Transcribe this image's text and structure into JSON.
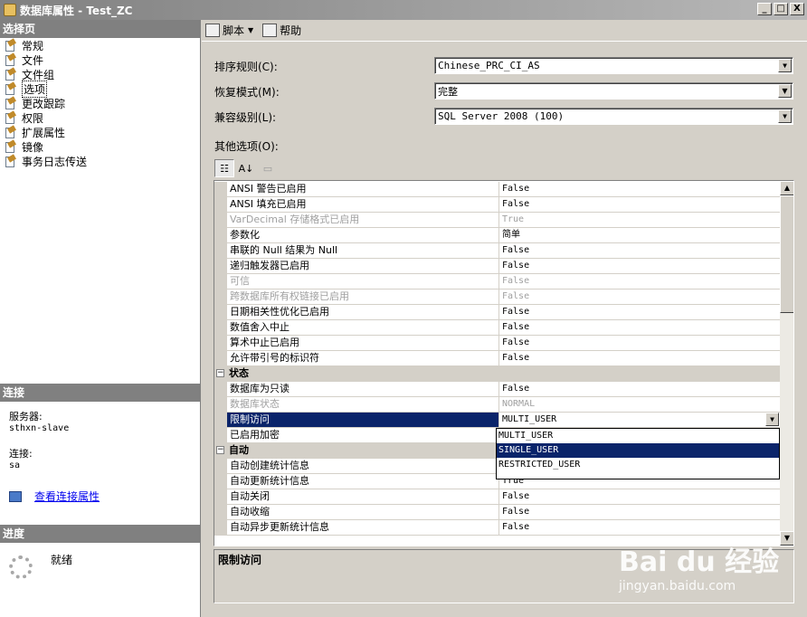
{
  "window": {
    "title": "数据库属性 - Test_ZC",
    "min": "_",
    "max": "□",
    "close": "X"
  },
  "left": {
    "select_page_header": "选择页",
    "nav_items": [
      "常规",
      "文件",
      "文件组",
      "选项",
      "更改跟踪",
      "权限",
      "扩展属性",
      "镜像",
      "事务日志传送"
    ],
    "selected": "选项",
    "connection_header": "连接",
    "server_label": "服务器:",
    "server_value": "sthxn-slave",
    "conn_label": "连接:",
    "conn_value": "sa",
    "view_conn_link": "查看连接属性",
    "progress_header": "进度",
    "progress_status": "就绪"
  },
  "toolbar": {
    "script": "脚本",
    "help": "帮助"
  },
  "form": {
    "collation_label": "排序规则(C):",
    "collation_value": "Chinese_PRC_CI_AS",
    "recovery_label": "恢复模式(M):",
    "recovery_value": "完整",
    "compat_label": "兼容级别(L):",
    "compat_value": "SQL Server 2008 (100)",
    "other_label": "其他选项(O):"
  },
  "grid": {
    "rows": [
      {
        "name": "ANSI 警告已启用",
        "value": "False"
      },
      {
        "name": "ANSI 填充已启用",
        "value": "False"
      },
      {
        "name": "VarDecimal 存储格式已启用",
        "value": "True",
        "disabled": true
      },
      {
        "name": "参数化",
        "value": "简单"
      },
      {
        "name": "串联的 Null 结果为 Null",
        "value": "False"
      },
      {
        "name": "递归触发器已启用",
        "value": "False"
      },
      {
        "name": "可信",
        "value": "False",
        "disabled": true
      },
      {
        "name": "跨数据库所有权链接已启用",
        "value": "False",
        "disabled": true
      },
      {
        "name": "日期相关性优化已启用",
        "value": "False"
      },
      {
        "name": "数值舍入中止",
        "value": "False"
      },
      {
        "name": "算术中止已启用",
        "value": "False"
      },
      {
        "name": "允许带引号的标识符",
        "value": "False"
      },
      {
        "name": "状态",
        "category": true
      },
      {
        "name": "数据库为只读",
        "value": "False"
      },
      {
        "name": "数据库状态",
        "value": "NORMAL",
        "disabled": true
      },
      {
        "name": "限制访问",
        "value": "MULTI_USER",
        "selected": true
      },
      {
        "name": "已启用加密",
        "value": ""
      },
      {
        "name": "自动",
        "category": true
      },
      {
        "name": "自动创建统计信息",
        "value": ""
      },
      {
        "name": "自动更新统计信息",
        "value": "True"
      },
      {
        "name": "自动关闭",
        "value": "False"
      },
      {
        "name": "自动收缩",
        "value": "False"
      },
      {
        "name": "自动异步更新统计信息",
        "value": "False"
      }
    ],
    "dropdown_options": [
      "MULTI_USER",
      "SINGLE_USER",
      "RESTRICTED_USER"
    ],
    "dropdown_highlight": "SINGLE_USER"
  },
  "description": {
    "title": "限制访问"
  },
  "watermark": {
    "brand": "Bai du 经验",
    "url": "jingyan.baidu.com"
  }
}
